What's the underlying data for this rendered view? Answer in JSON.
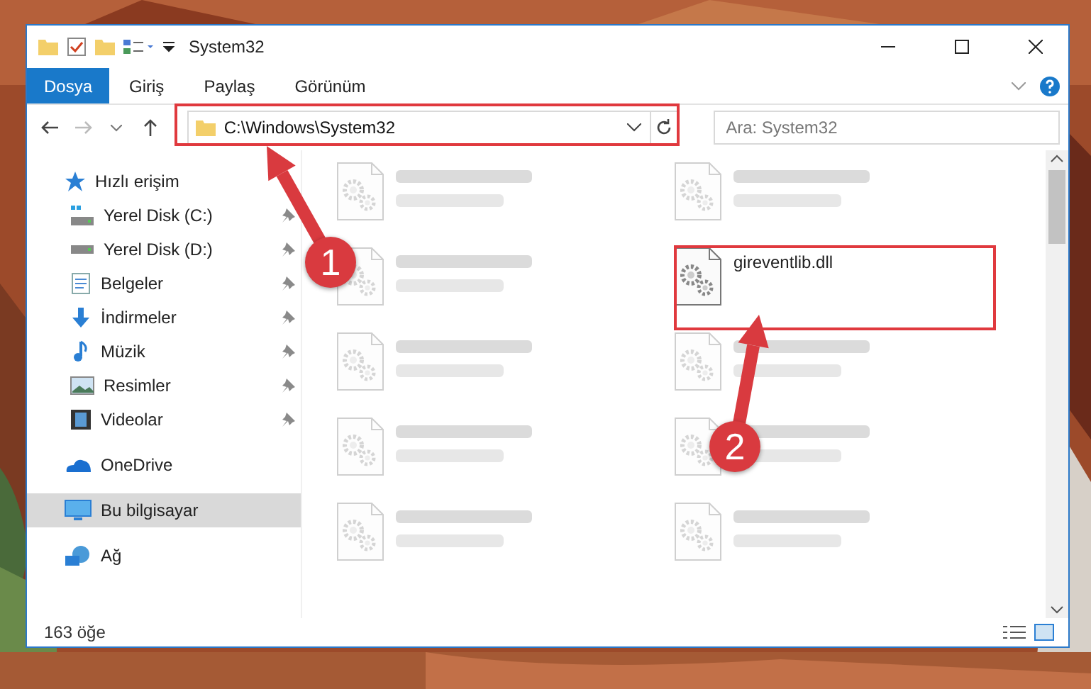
{
  "window": {
    "title": "System32"
  },
  "ribbon_tabs": [
    {
      "label": "Dosya",
      "selected": true
    },
    {
      "label": "Giriş",
      "selected": false
    },
    {
      "label": "Paylaş",
      "selected": false
    },
    {
      "label": "Görünüm",
      "selected": false
    }
  ],
  "address": {
    "path": "C:\\Windows\\System32"
  },
  "search": {
    "placeholder": "Ara: System32"
  },
  "nav": [
    {
      "label": "Hızlı erişim",
      "kind": "star",
      "selected": false,
      "children": [
        {
          "label": "Yerel Disk (C:)",
          "kind": "disk-c",
          "selected": false
        },
        {
          "label": "Yerel Disk (D:)",
          "kind": "disk",
          "selected": false
        },
        {
          "label": "Belgeler",
          "kind": "document",
          "selected": false
        },
        {
          "label": "İndirmeler",
          "kind": "download",
          "selected": false
        },
        {
          "label": "Müzik",
          "kind": "music",
          "selected": false
        },
        {
          "label": "Resimler",
          "kind": "pictures",
          "selected": false
        },
        {
          "label": "Videolar",
          "kind": "videos",
          "selected": false
        }
      ]
    },
    {
      "label": "OneDrive",
      "kind": "cloud",
      "selected": false
    },
    {
      "label": "Bu bilgisayar",
      "kind": "computer",
      "selected": true
    },
    {
      "label": "Ağ",
      "kind": "network",
      "selected": false
    }
  ],
  "files": [
    {
      "blurred": true
    },
    {
      "blurred": true
    },
    {
      "blurred": true
    },
    {
      "name": "gireventlib.dll",
      "blurred": false
    },
    {
      "blurred": true
    },
    {
      "blurred": true
    },
    {
      "blurred": true
    },
    {
      "blurred": true
    },
    {
      "blurred": true
    },
    {
      "blurred": true
    }
  ],
  "status_bar": {
    "count": "163 öğe"
  },
  "annotations": [
    {
      "number": "1"
    },
    {
      "number": "2"
    }
  ]
}
